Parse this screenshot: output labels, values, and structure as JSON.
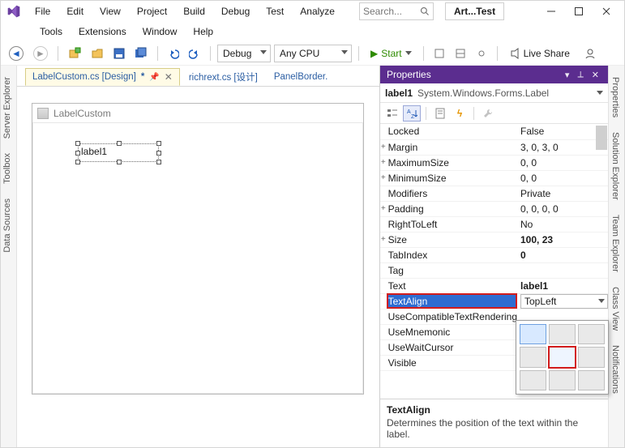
{
  "menu": {
    "items": [
      "File",
      "Edit",
      "View",
      "Project",
      "Build",
      "Debug",
      "Test",
      "Analyze"
    ],
    "items2": [
      "Tools",
      "Extensions",
      "Window",
      "Help"
    ]
  },
  "search": {
    "placeholder": "Search..."
  },
  "solution_pill": "Art...Test",
  "toolbar": {
    "config": "Debug",
    "platform": "Any CPU",
    "start": "Start",
    "live_share": "Live Share"
  },
  "tabs": {
    "active": {
      "label": "LabelCustom.cs [Design]",
      "dirty": "*"
    },
    "others": [
      "richrext.cs [设计]",
      "PanelBorder."
    ]
  },
  "rails": {
    "left": [
      "Server Explorer",
      "Toolbox",
      "Data Sources"
    ],
    "right": [
      "Properties",
      "Solution Explorer",
      "Team Explorer",
      "Class View",
      "Notifications"
    ]
  },
  "designer": {
    "form_title": "LabelCustom",
    "label_text": "label1"
  },
  "props": {
    "title": "Properties",
    "object_name": "label1",
    "object_type": "System.Windows.Forms.Label",
    "rows": [
      {
        "exp": "",
        "name": "Locked",
        "value": "False"
      },
      {
        "exp": "+",
        "name": "Margin",
        "value": "3, 0, 3, 0"
      },
      {
        "exp": "+",
        "name": "MaximumSize",
        "value": "0, 0"
      },
      {
        "exp": "+",
        "name": "MinimumSize",
        "value": "0, 0"
      },
      {
        "exp": "",
        "name": "Modifiers",
        "value": "Private"
      },
      {
        "exp": "+",
        "name": "Padding",
        "value": "0, 0, 0, 0"
      },
      {
        "exp": "",
        "name": "RightToLeft",
        "value": "No"
      },
      {
        "exp": "+",
        "name": "Size",
        "value": "100, 23",
        "bold": true
      },
      {
        "exp": "",
        "name": "TabIndex",
        "value": "0",
        "bold": true
      },
      {
        "exp": "",
        "name": "Tag",
        "value": ""
      },
      {
        "exp": "",
        "name": "Text",
        "value": "label1",
        "bold": true
      },
      {
        "exp": "",
        "name": "TextAlign",
        "value": "TopLeft",
        "selected": true,
        "combo": true
      },
      {
        "exp": "",
        "name": "UseCompatibleTextRendering",
        "value": ""
      },
      {
        "exp": "",
        "name": "UseMnemonic",
        "value": ""
      },
      {
        "exp": "",
        "name": "UseWaitCursor",
        "value": ""
      },
      {
        "exp": "",
        "name": "Visible",
        "value": ""
      }
    ],
    "desc_title": "TextAlign",
    "desc_text": "Determines the position of the text within the label."
  }
}
